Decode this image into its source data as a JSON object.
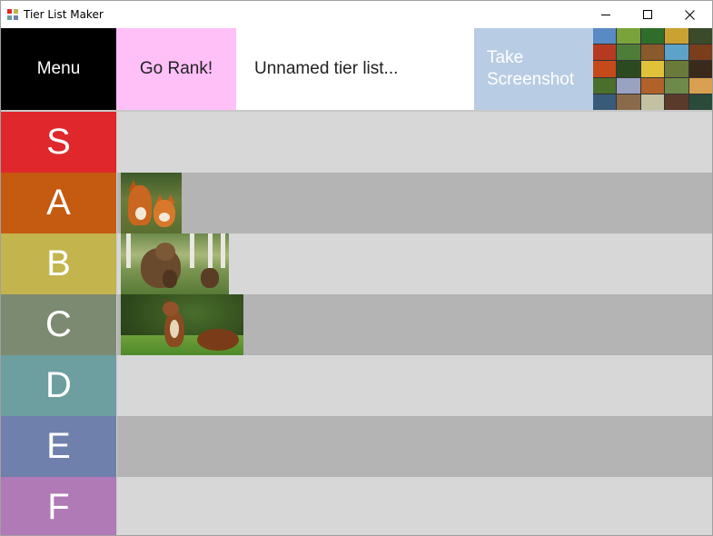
{
  "window": {
    "title": "Tier List Maker",
    "icon": "tier-list-app-icon",
    "controls": [
      "minimize-icon",
      "maximize-icon",
      "close-icon"
    ]
  },
  "toolbar": {
    "menu_label": "Menu",
    "rank_label": "Go Rank!",
    "tierlist_name": "Unnamed tier list...",
    "screenshot_label": "Take Screenshot",
    "colors": {
      "menu_bg": "#000000",
      "rank_bg": "#ffc0f7",
      "screenshot_bg": "#b8cce4"
    }
  },
  "tiers": [
    {
      "label": "S",
      "color": "#e0272b",
      "items": []
    },
    {
      "label": "A",
      "color": "#c55a11",
      "items": [
        "fox-photo"
      ]
    },
    {
      "label": "B",
      "color": "#c3b44e",
      "items": [
        "bear-photo"
      ]
    },
    {
      "label": "C",
      "color": "#7d8a72",
      "items": [
        "squirrel-photo"
      ]
    },
    {
      "label": "D",
      "color": "#6d9ea0",
      "items": []
    },
    {
      "label": "E",
      "color": "#7080ad",
      "items": []
    },
    {
      "label": "F",
      "color": "#b07ab6",
      "items": []
    }
  ]
}
